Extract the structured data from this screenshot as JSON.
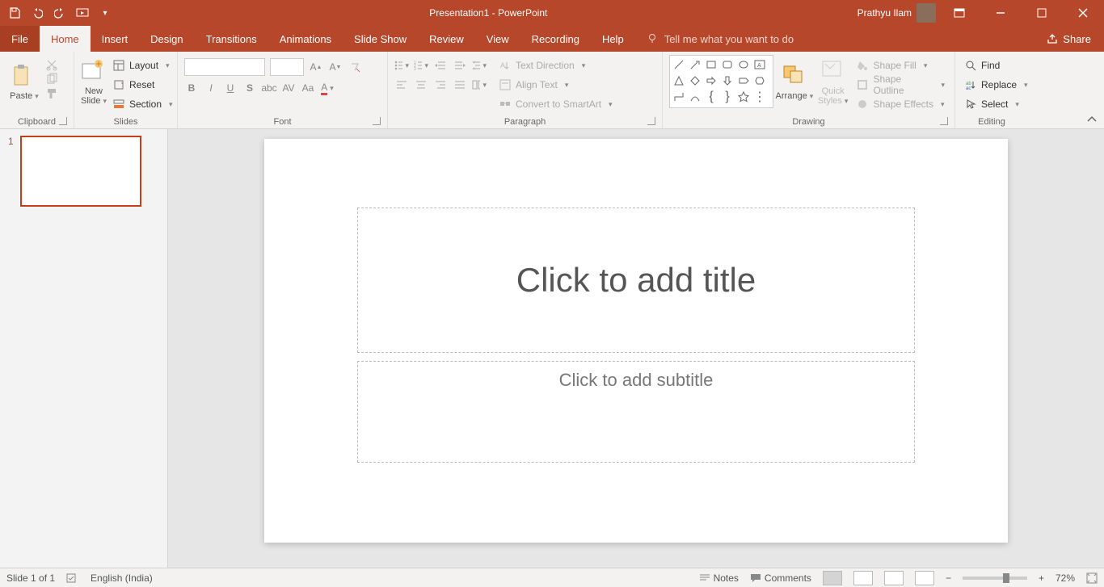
{
  "titlebar": {
    "document_title": "Presentation1 - PowerPoint",
    "user_name": "Prathyu Ilam"
  },
  "tabs": {
    "file": "File",
    "home": "Home",
    "insert": "Insert",
    "design": "Design",
    "transitions": "Transitions",
    "animations": "Animations",
    "slideshow": "Slide Show",
    "review": "Review",
    "view": "View",
    "recording": "Recording",
    "help": "Help",
    "tell_me": "Tell me what you want to do",
    "share": "Share"
  },
  "ribbon": {
    "clipboard": {
      "label": "Clipboard",
      "paste": "Paste"
    },
    "slides": {
      "label": "Slides",
      "new_slide": "New\nSlide",
      "layout": "Layout",
      "reset": "Reset",
      "section": "Section"
    },
    "font": {
      "label": "Font"
    },
    "paragraph": {
      "label": "Paragraph",
      "text_direction": "Text Direction",
      "align_text": "Align Text",
      "convert_smartart": "Convert to SmartArt"
    },
    "drawing": {
      "label": "Drawing",
      "arrange": "Arrange",
      "quick_styles": "Quick\nStyles",
      "shape_fill": "Shape Fill",
      "shape_outline": "Shape Outline",
      "shape_effects": "Shape Effects"
    },
    "editing": {
      "label": "Editing",
      "find": "Find",
      "replace": "Replace",
      "select": "Select"
    }
  },
  "thumbnails": {
    "slide1_number": "1"
  },
  "slide": {
    "title_placeholder": "Click to add title",
    "subtitle_placeholder": "Click to add subtitle"
  },
  "statusbar": {
    "slide_counter": "Slide 1 of 1",
    "language": "English (India)",
    "notes": "Notes",
    "comments": "Comments",
    "zoom_percent": "72%"
  }
}
